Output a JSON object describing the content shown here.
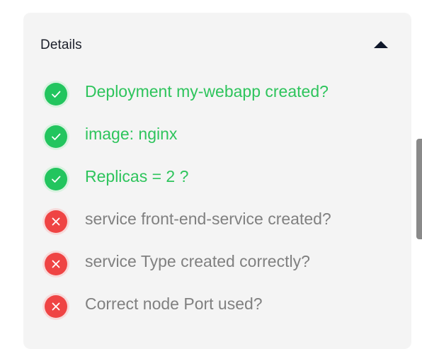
{
  "details": {
    "title": "Details",
    "toggle_icon": "caret-up-icon"
  },
  "colors": {
    "pass_text": "#2ec45c",
    "pass_icon": "#22c55e",
    "fail_text": "#808080",
    "fail_icon": "#ef4444"
  },
  "checks": [
    {
      "label": "Deployment my-webapp created?",
      "status": "pass"
    },
    {
      "label": "image: nginx",
      "status": "pass"
    },
    {
      "label": "Replicas = 2 ?",
      "status": "pass"
    },
    {
      "label": "service front-end-service created?",
      "status": "fail"
    },
    {
      "label": "service Type created correctly?",
      "status": "fail"
    },
    {
      "label": "Correct node Port used?",
      "status": "fail"
    }
  ]
}
